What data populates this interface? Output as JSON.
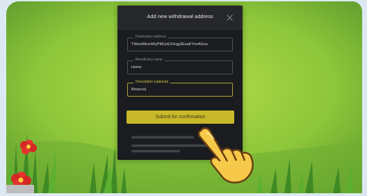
{
  "dialog": {
    "title": "Add new withdrawal address",
    "close_icon": "close-icon"
  },
  "fields": [
    {
      "label": "Destination address",
      "value": "TWeuWkrmWyPMUzEXrkqg3EuaKYnvAGoo"
    },
    {
      "label": "Beneficiary name",
      "value": "Home"
    },
    {
      "label": "Description (optional)",
      "value": "Binance|"
    }
  ],
  "submit_label": "Submit for confirmation",
  "colors": {
    "accent": "#c9b92a",
    "modal_bg": "#1a1c1f",
    "grass": "#7cc23a"
  },
  "icons": {
    "pointer": "pointing-hand-icon",
    "flower": "flower-icon"
  }
}
